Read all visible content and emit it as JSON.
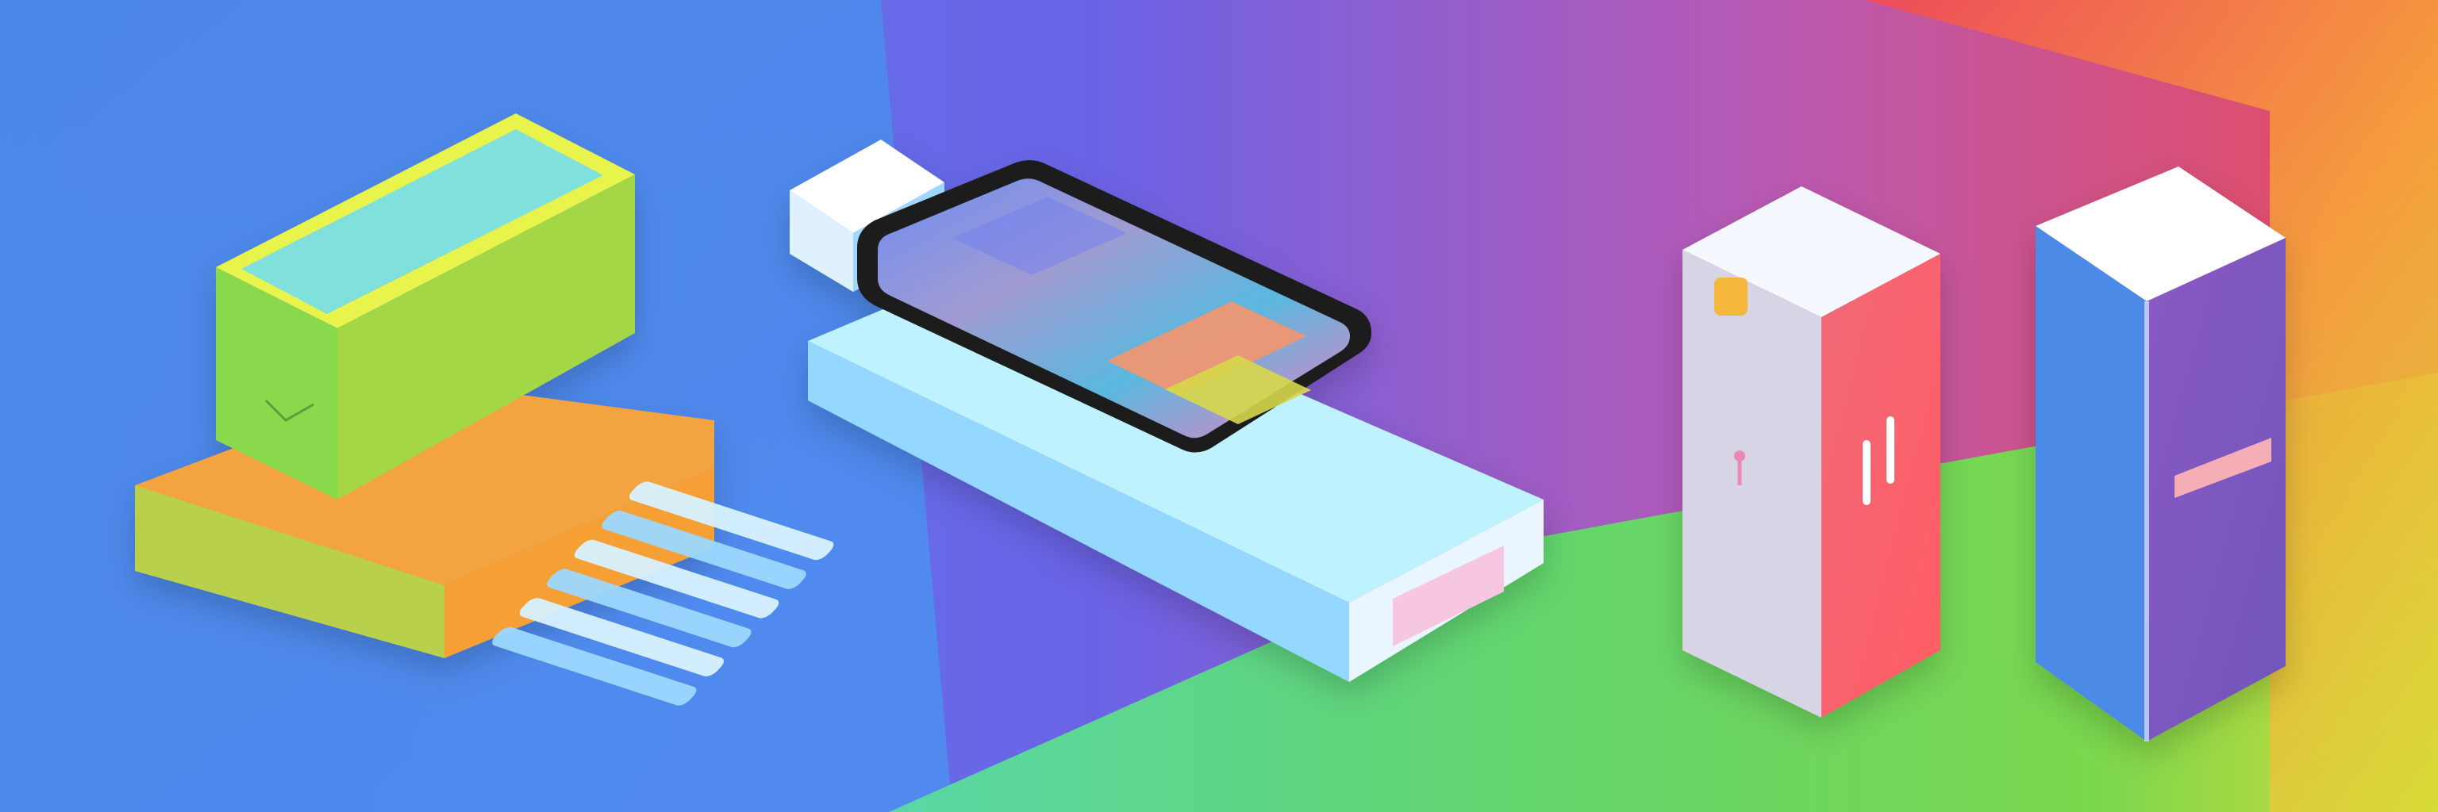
{
  "image": {
    "palette": {
      "sky_left": "#4f8cf0",
      "sky_mid": "#6b63e6",
      "sky_right": "#e94b57",
      "floor_green": "#63d66f",
      "floor_yellow": "#d8db39",
      "accent_orange": "#f7a43a",
      "accent_cyan": "#7de4e0",
      "accent_blue": "#4c88e8",
      "accent_pink": "#f16a78",
      "accent_purple": "#7a59c6"
    },
    "objects": [
      "stacked-colorful-blocks",
      "striped-floor-mat",
      "smartphone-on-platform",
      "white-platform-block",
      "left-tall-cabinet",
      "right-tall-cabinet"
    ]
  }
}
